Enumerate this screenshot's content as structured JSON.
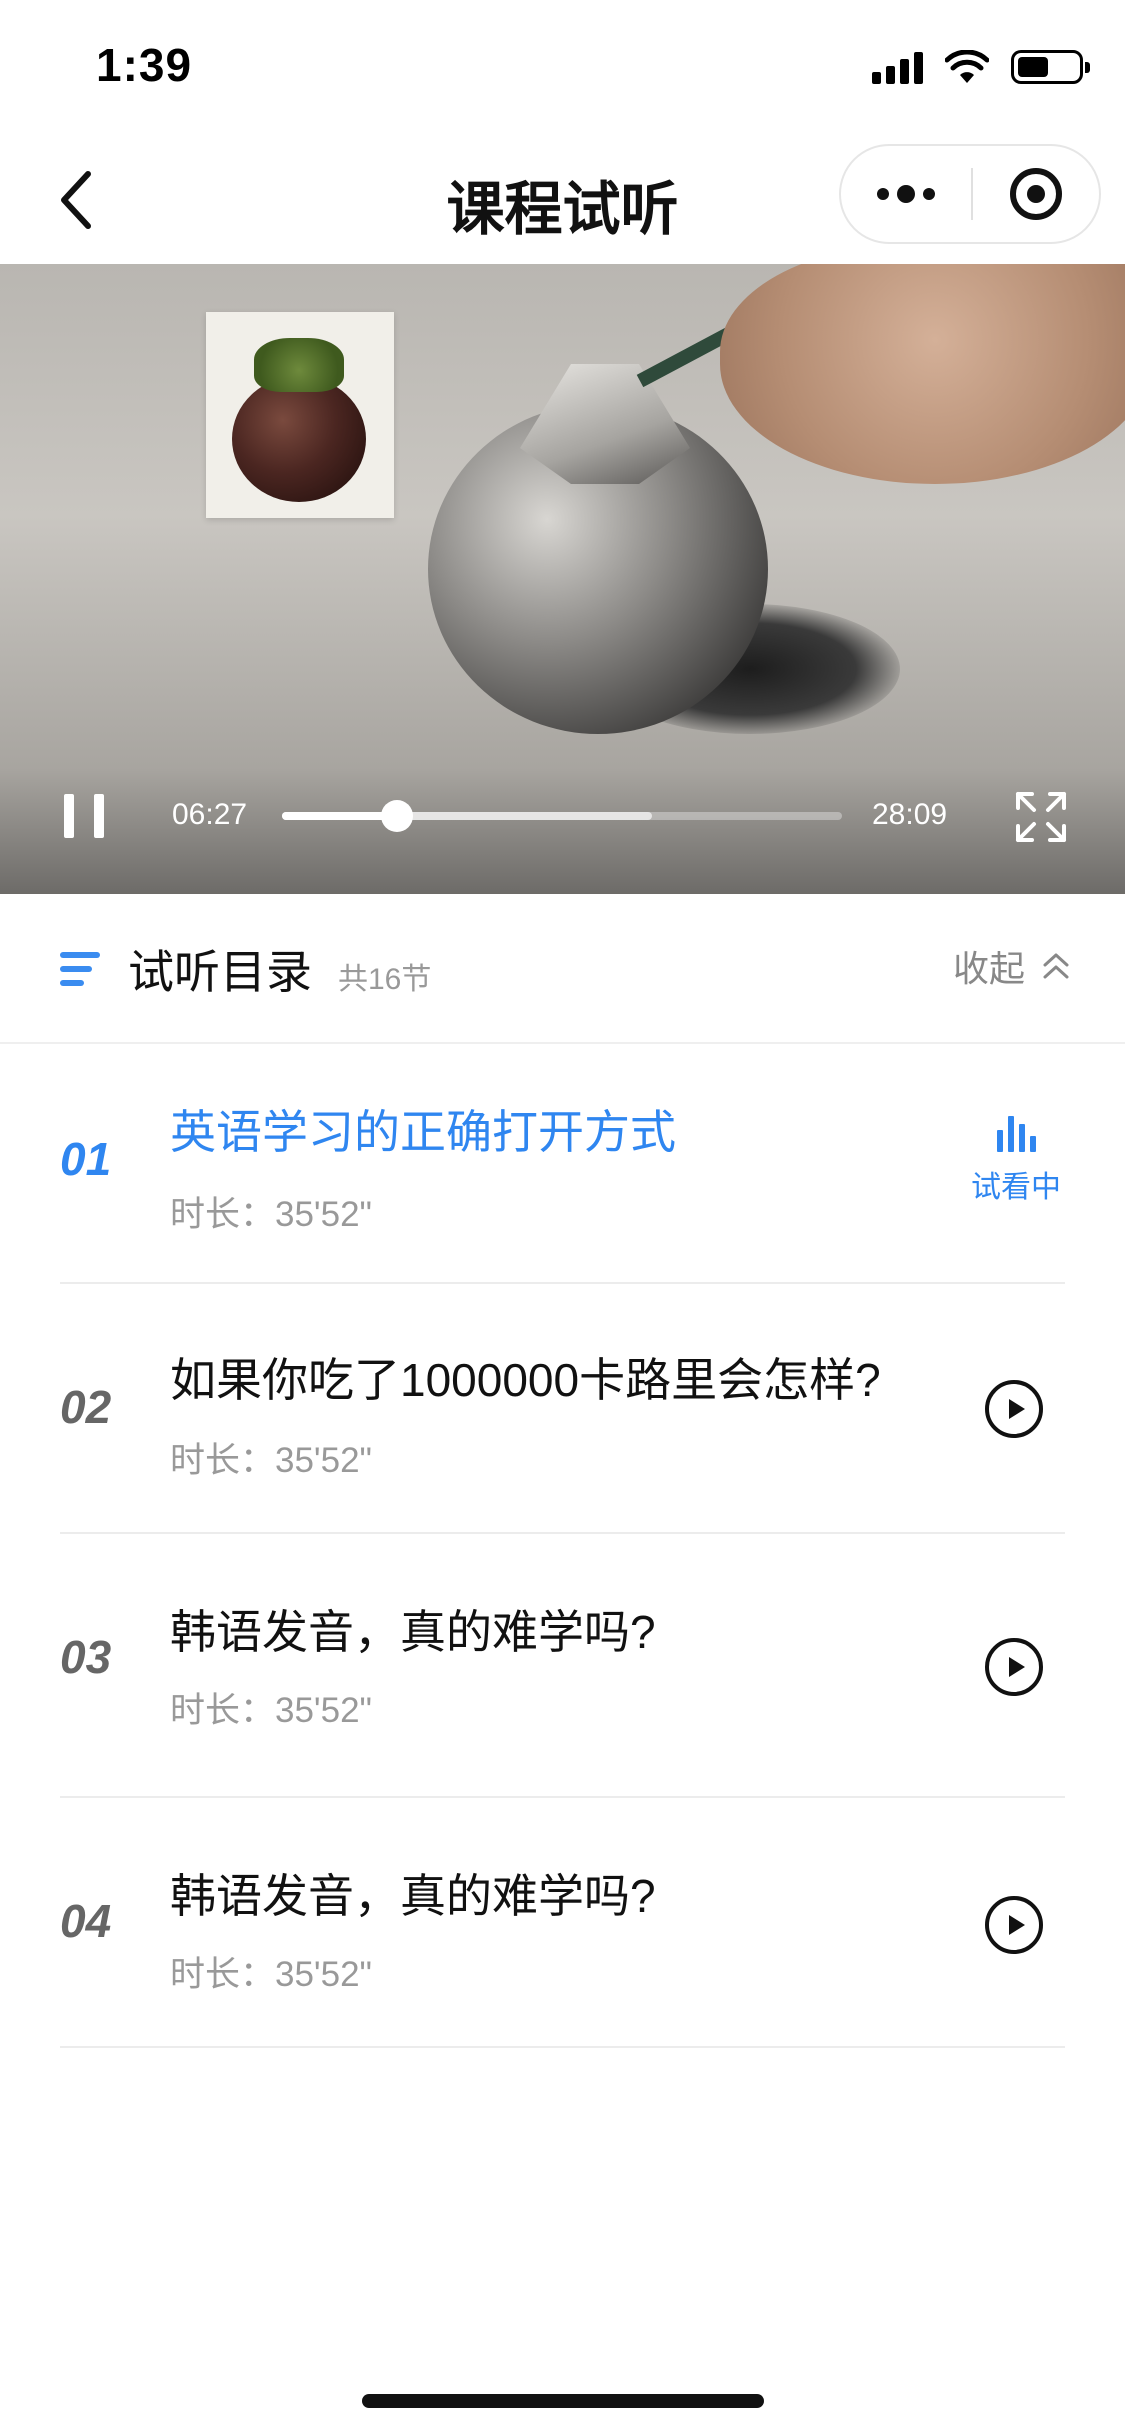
{
  "status_bar": {
    "time": "1:39"
  },
  "nav": {
    "title": "课程试听"
  },
  "video": {
    "current_time": "06:27",
    "total_time": "28:09",
    "progress": 0.205,
    "buffered": 0.66
  },
  "catalog": {
    "title": "试听目录",
    "count": "共16节",
    "collapse_label": "收起"
  },
  "lessons": [
    {
      "number": "01",
      "title": "英语学习的正确打开方式",
      "duration": "时长：35'52\"",
      "status": "试看中"
    },
    {
      "number": "02",
      "title": "如果你吃了1000000卡路里会怎样?",
      "duration": "时长：35'52\""
    },
    {
      "number": "03",
      "title": "韩语发音，真的难学吗?",
      "duration": "时长：35'52\""
    },
    {
      "number": "04",
      "title": "韩语发音，真的难学吗?",
      "duration": "时长：35'52\""
    }
  ],
  "colors": {
    "accent": "#2f86f0",
    "text": "#111111",
    "muted": "#999999"
  }
}
